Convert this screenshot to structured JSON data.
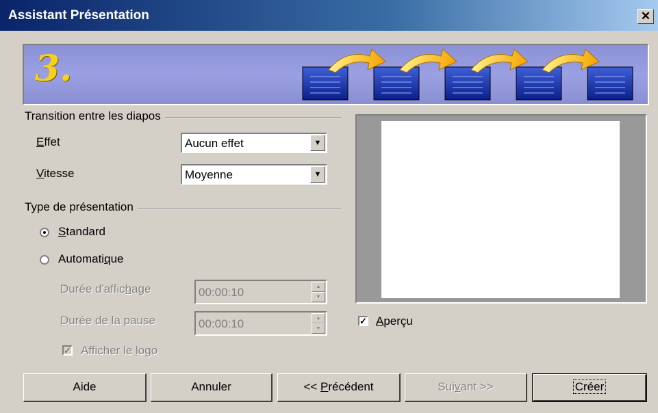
{
  "window": {
    "title": "Assistant Présentation",
    "close_label": "✕"
  },
  "banner": {
    "step": "3."
  },
  "transition": {
    "group_label": "Transition entre les diapos",
    "effect_label": "Effet",
    "effect_value": "Aucun effet",
    "speed_label": "Vitesse",
    "speed_value": "Moyenne"
  },
  "presentation": {
    "group_label": "Type de présentation",
    "standard_label": "Standard",
    "standard_checked": true,
    "automatic_label": "Automatique",
    "automatic_checked": false,
    "display_duration_label": "Durée d'affichage",
    "display_duration_value": "00:00:10",
    "pause_duration_label": "Durée de la pause",
    "pause_duration_value": "00:00:10",
    "show_logo_label": "Afficher le logo",
    "show_logo_checked": true
  },
  "preview": {
    "checkbox_label": "Aperçu",
    "checked": true
  },
  "buttons": {
    "help": "Aide",
    "cancel": "Annuler",
    "previous": "<< Précédent",
    "next": "Suivant >>",
    "create": "Créer"
  },
  "colors": {
    "title_bar": "#0a246a",
    "banner": "#9aa0e2",
    "face": "#d4d0c8",
    "step_number": "#f7d117"
  },
  "icons": [
    "close-icon",
    "slide-icon",
    "arrow-icon",
    "dropdown-arrow-icon",
    "spin-up-icon",
    "spin-down-icon"
  ]
}
